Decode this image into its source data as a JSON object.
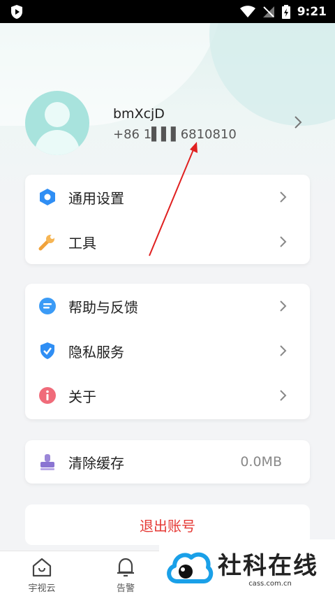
{
  "status_bar": {
    "time": "9:21"
  },
  "profile": {
    "username": "bmXcjD",
    "phone": "+86 1▌▌▌6810810"
  },
  "menu_group1": [
    {
      "label": "通用设置",
      "icon": "hexagon-settings-icon"
    },
    {
      "label": "工具",
      "icon": "wrench-icon"
    }
  ],
  "menu_group2": [
    {
      "label": "帮助与反馈",
      "icon": "chat-bubble-icon"
    },
    {
      "label": "隐私服务",
      "icon": "shield-check-icon"
    },
    {
      "label": "关于",
      "icon": "info-icon"
    }
  ],
  "cache": {
    "label": "清除缓存",
    "value": "0.0MB",
    "icon": "stamp-icon"
  },
  "logout": {
    "label": "退出账号"
  },
  "bottom_nav": [
    {
      "label": "宇视云",
      "icon": "home-icon"
    },
    {
      "label": "告警",
      "icon": "bell-icon"
    }
  ],
  "watermark": {
    "title": "社科在线",
    "sub": "cass.com.cn"
  },
  "colors": {
    "accent_blue": "#2f8ef4",
    "danger_red": "#e53935",
    "avatar_bg": "#a8e3dd"
  }
}
